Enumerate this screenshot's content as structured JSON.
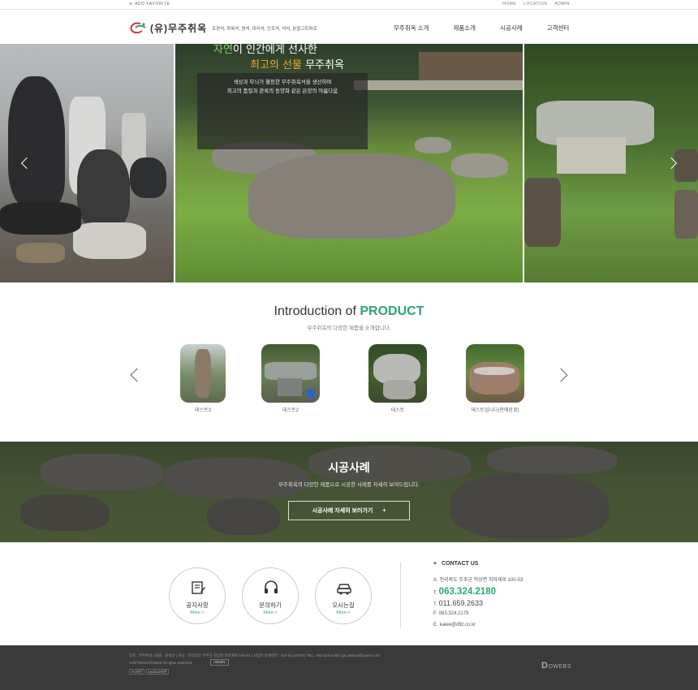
{
  "topbar": {
    "favorite": "ADD FAVORITE",
    "links": [
      "HOME",
      "LOCATION",
      "ADMIN"
    ]
  },
  "header": {
    "logo_text": "(유)무주취옥",
    "logo_sub": "조경석, 취옥석, 원석, 대리석, 인조석, 석석, 분할고트퍼로",
    "nav": [
      "무주취옥 소개",
      "제품소개",
      "시공사례",
      "고객센터"
    ]
  },
  "hero": {
    "caption_line1_highlight": "자연",
    "caption_line1_rest": "이 인간에게 선사한",
    "caption_line2_highlight": "최고의 선물",
    "caption_line2_rest": " 무주취옥",
    "caption_body_1": "색상과 무늬가 월등한 무주취옥석을 생산하며",
    "caption_body_2": "최고의 품질과 관록의 동양화 같은 은양의 아름다움"
  },
  "product": {
    "title_prefix": "Introduction of ",
    "title_highlight": "PRODUCT",
    "subtitle": "무주취옥의 다양한 제품을 소개합니다.",
    "items": [
      {
        "label": "테스트3"
      },
      {
        "label": "테스트2"
      },
      {
        "label": "테스트"
      },
      {
        "label": "테스트입니다(판매완료)"
      }
    ]
  },
  "cases": {
    "title": "시공사례",
    "subtitle": "무주취옥의 다양한 제품으로 시공한 사례를 자세히 보여드립니다.",
    "button": "시공사례 자세히 보러가기",
    "button_icon": "+"
  },
  "quick": [
    {
      "label": "공지사항",
      "more": "More >",
      "icon": "notice-icon"
    },
    {
      "label": "문의하기",
      "more": "More >",
      "icon": "headset-icon"
    },
    {
      "label": "오시는길",
      "more": "More >",
      "icon": "car-icon"
    }
  ],
  "contact": {
    "title": "CONTACT US",
    "address_key": "A.",
    "address": "전라북도 무주군 적상면 치마재로 100-53",
    "tel1_key": "T.",
    "tel1": "063.324.2180",
    "tel2_key": "T.",
    "tel2": "011.659.2633",
    "fax_key": "F.",
    "fax": "063.324.2179",
    "email_key": "E.",
    "email": "kalee@dflz.co.kr"
  },
  "footer": {
    "info": "상호 : 무주취옥 | 대표 : 윤박순 | 주소 : 전라북도 무주군 적상면 치마재로 100-53 | 사업자 등록번호 : 407-01-10703 | TEL : 063-324-2180 | gs.uwsim3@naver.com",
    "copyright": "COPYRIGHT©2015 All rights reserved.",
    "admin": "ADMIN",
    "btn_pc": "PC버전",
    "btn_mobile": "MOBILE버전",
    "brand": "OWEBS",
    "brand_letter": "D"
  },
  "colors": {
    "accent": "#2ea56e",
    "footer_bg": "#3a3a3a",
    "caption_orange": "#f1a83a"
  }
}
